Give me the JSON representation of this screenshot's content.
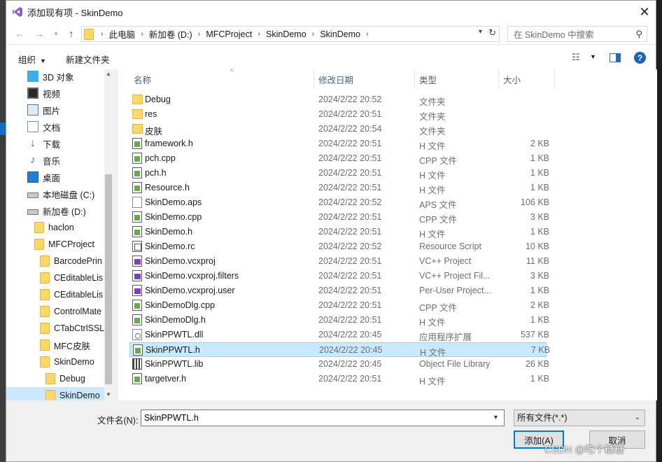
{
  "window": {
    "title": "添加现有项 - SkinDemo"
  },
  "address": {
    "crumbs": [
      "此电脑",
      "新加卷 (D:)",
      "MFCProject",
      "SkinDemo",
      "SkinDemo"
    ],
    "search_placeholder": "在 SkinDemo 中搜索"
  },
  "toolbar": {
    "organize": "组织",
    "new_folder": "新建文件夹",
    "help": "?"
  },
  "nav": {
    "items": [
      {
        "label": "3D 对象",
        "icon": "3d-objects-icon"
      },
      {
        "label": "视频",
        "icon": "video-icon"
      },
      {
        "label": "图片",
        "icon": "pictures-icon"
      },
      {
        "label": "文档",
        "icon": "documents-icon"
      },
      {
        "label": "下载",
        "icon": "download-icon"
      },
      {
        "label": "音乐",
        "icon": "music-icon"
      },
      {
        "label": "桌面",
        "icon": "desktop-icon"
      },
      {
        "label": "本地磁盘 (C:)",
        "icon": "drive-icon"
      },
      {
        "label": "新加卷 (D:)",
        "icon": "drive-icon"
      },
      {
        "label": "haclon",
        "icon": "folder-icon"
      },
      {
        "label": "MFCProject",
        "icon": "folder-icon"
      },
      {
        "label": "BarcodePrin",
        "icon": "folder-icon"
      },
      {
        "label": "CEditableLis",
        "icon": "folder-icon"
      },
      {
        "label": "CEditableLis",
        "icon": "folder-icon"
      },
      {
        "label": "ControlMate",
        "icon": "folder-icon"
      },
      {
        "label": "CTabCtrlSSL",
        "icon": "folder-icon"
      },
      {
        "label": "MFC皮肤",
        "icon": "folder-icon"
      },
      {
        "label": "SkinDemo",
        "icon": "folder-icon"
      },
      {
        "label": "Debug",
        "icon": "folder-icon"
      },
      {
        "label": "SkinDemo",
        "icon": "folder-icon"
      }
    ]
  },
  "columns": {
    "name": "名称",
    "date": "修改日期",
    "type": "类型",
    "size": "大小"
  },
  "files": [
    {
      "name": "Debug",
      "date": "2024/2/22 20:52",
      "type": "文件夹",
      "size": "",
      "icon": "folder"
    },
    {
      "name": "res",
      "date": "2024/2/22 20:51",
      "type": "文件夹",
      "size": "",
      "icon": "folder"
    },
    {
      "name": "皮肤",
      "date": "2024/2/22 20:54",
      "type": "文件夹",
      "size": "",
      "icon": "folder"
    },
    {
      "name": "framework.h",
      "date": "2024/2/22 20:51",
      "type": "H 文件",
      "size": "2 KB",
      "icon": "code"
    },
    {
      "name": "pch.cpp",
      "date": "2024/2/22 20:51",
      "type": "CPP 文件",
      "size": "1 KB",
      "icon": "code"
    },
    {
      "name": "pch.h",
      "date": "2024/2/22 20:51",
      "type": "H 文件",
      "size": "1 KB",
      "icon": "code"
    },
    {
      "name": "Resource.h",
      "date": "2024/2/22 20:51",
      "type": "H 文件",
      "size": "1 KB",
      "icon": "code"
    },
    {
      "name": "SkinDemo.aps",
      "date": "2024/2/22 20:52",
      "type": "APS 文件",
      "size": "106 KB",
      "icon": "blank"
    },
    {
      "name": "SkinDemo.cpp",
      "date": "2024/2/22 20:51",
      "type": "CPP 文件",
      "size": "3 KB",
      "icon": "code"
    },
    {
      "name": "SkinDemo.h",
      "date": "2024/2/22 20:51",
      "type": "H 文件",
      "size": "1 KB",
      "icon": "code"
    },
    {
      "name": "SkinDemo.rc",
      "date": "2024/2/22 20:52",
      "type": "Resource Script",
      "size": "10 KB",
      "icon": "rc"
    },
    {
      "name": "SkinDemo.vcxproj",
      "date": "2024/2/22 20:51",
      "type": "VC++ Project",
      "size": "11 KB",
      "icon": "vc"
    },
    {
      "name": "SkinDemo.vcxproj.filters",
      "date": "2024/2/22 20:51",
      "type": "VC++ Project Fil...",
      "size": "3 KB",
      "icon": "vc"
    },
    {
      "name": "SkinDemo.vcxproj.user",
      "date": "2024/2/22 20:51",
      "type": "Per-User Project...",
      "size": "1 KB",
      "icon": "vc"
    },
    {
      "name": "SkinDemoDlg.cpp",
      "date": "2024/2/22 20:51",
      "type": "CPP 文件",
      "size": "2 KB",
      "icon": "code"
    },
    {
      "name": "SkinDemoDlg.h",
      "date": "2024/2/22 20:51",
      "type": "H 文件",
      "size": "1 KB",
      "icon": "code"
    },
    {
      "name": "SkinPPWTL.dll",
      "date": "2024/2/22 20:45",
      "type": "应用程序扩展",
      "size": "537 KB",
      "icon": "dll"
    },
    {
      "name": "SkinPPWTL.h",
      "date": "2024/2/22 20:45",
      "type": "H 文件",
      "size": "7 KB",
      "icon": "code"
    },
    {
      "name": "SkinPPWTL.lib",
      "date": "2024/2/22 20:45",
      "type": "Object File Library",
      "size": "26 KB",
      "icon": "lib"
    },
    {
      "name": "targetver.h",
      "date": "2024/2/22 20:51",
      "type": "H 文件",
      "size": "1 KB",
      "icon": "code"
    }
  ],
  "selected_file_index": 17,
  "selected_nav_index": 19,
  "footer": {
    "filename_label": "文件名(N):",
    "filename_value": "SkinPPWTL.h",
    "filetype_value": "所有文件(*.*)",
    "add_button": "添加(A)",
    "cancel_button": "取消"
  },
  "watermark": "CSDN @吃个糖糖",
  "colors": {
    "accent": "#0078d7",
    "selection": "#cce8ff",
    "folder": "#ffd867"
  }
}
